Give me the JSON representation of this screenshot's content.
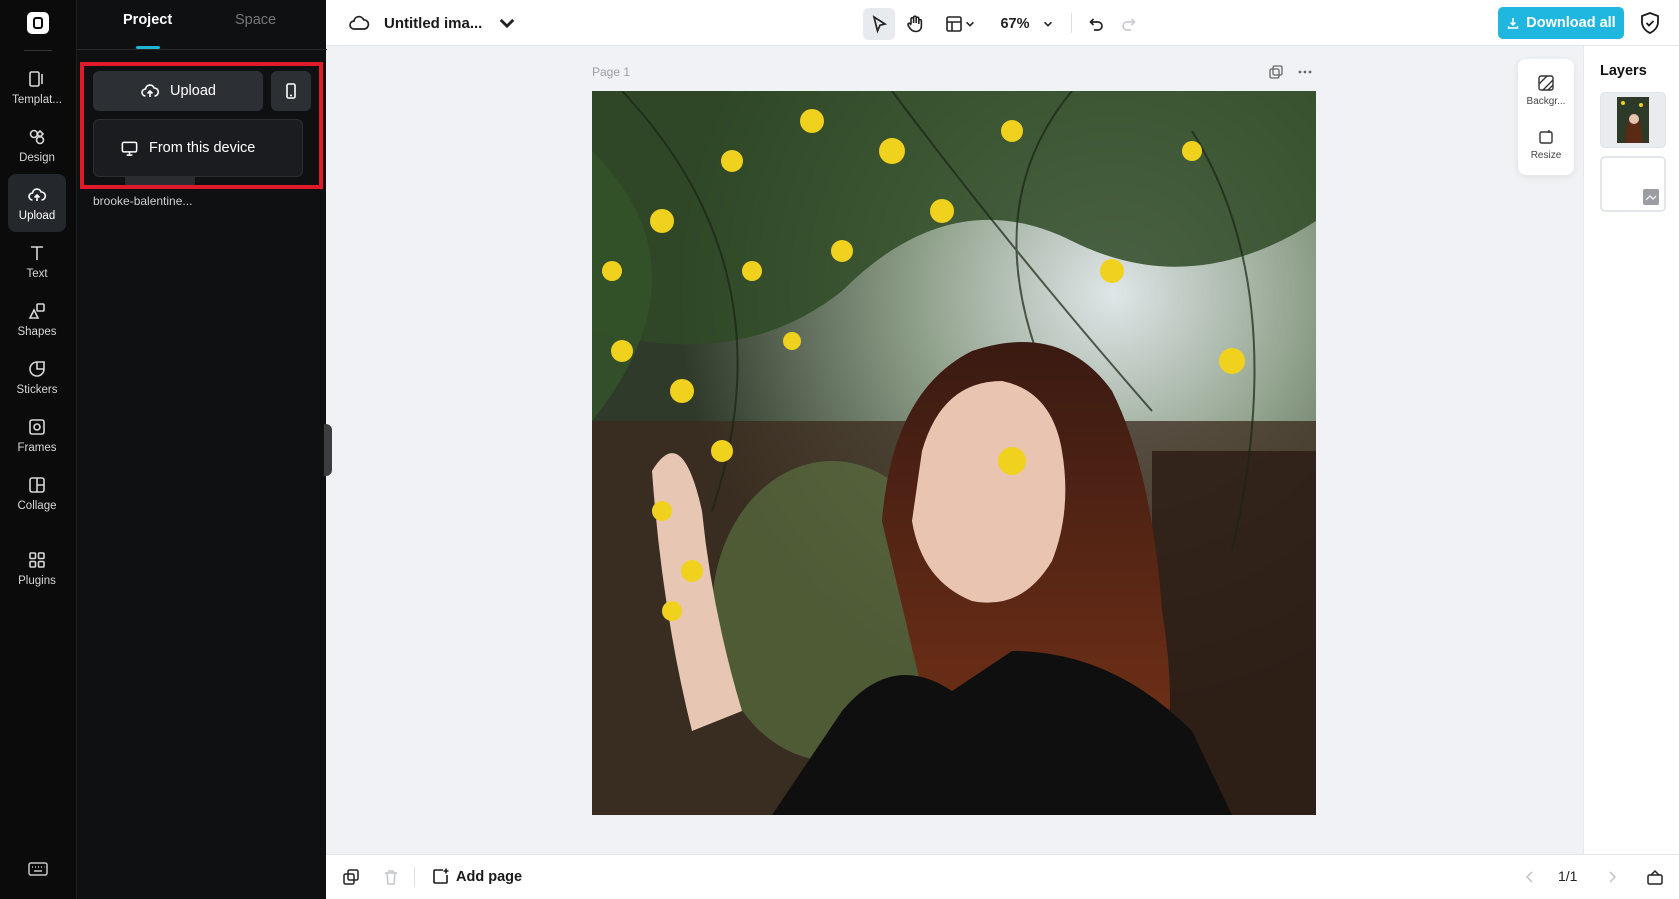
{
  "rail": {
    "items": [
      {
        "label": "Templat...",
        "icon": "templates-icon"
      },
      {
        "label": "Design",
        "icon": "design-icon"
      },
      {
        "label": "Upload",
        "icon": "upload-cloud-icon",
        "active": true
      },
      {
        "label": "Text",
        "icon": "text-icon"
      },
      {
        "label": "Shapes",
        "icon": "shapes-icon"
      },
      {
        "label": "Stickers",
        "icon": "stickers-icon"
      },
      {
        "label": "Frames",
        "icon": "frames-icon"
      },
      {
        "label": "Collage",
        "icon": "collage-icon"
      },
      {
        "label": "Plugins",
        "icon": "plugins-icon"
      }
    ]
  },
  "panel": {
    "tabs": [
      "Project",
      "Space"
    ],
    "upload_label": "Upload",
    "dropdown_option": "From this device",
    "file_name": "brooke-balentine..."
  },
  "topbar": {
    "doc_title": "Untitled ima...",
    "zoom": "67%",
    "download_label": "Download all"
  },
  "canvas": {
    "page_label": "Page 1"
  },
  "float_tools": {
    "background_label": "Backgr...",
    "resize_label": "Resize"
  },
  "layers": {
    "title": "Layers"
  },
  "bottombar": {
    "add_page_label": "Add page",
    "pager": "1/1"
  },
  "colors": {
    "accent": "#1fb6e0",
    "highlight": "#e0192b",
    "rail_bg": "#0b0b0c"
  }
}
